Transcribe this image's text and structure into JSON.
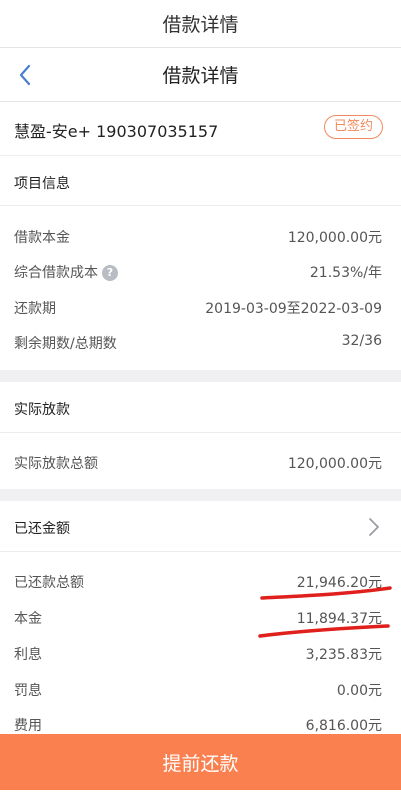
{
  "top_title": "借款详情",
  "nav": {
    "title": "借款详情",
    "back_icon": "chevron-left-icon"
  },
  "loan": {
    "name": "慧盈-安e+ 190307035157",
    "status_badge": "已签约"
  },
  "project_info": {
    "title": "项目信息",
    "rows": [
      {
        "label": "借款本金",
        "value": "120,000.00元"
      },
      {
        "label": "综合借款成本",
        "value": "21.53%/年",
        "has_help": true
      },
      {
        "label": "还款期",
        "value": "2019-03-09至2022-03-09"
      },
      {
        "label": "剩余期数/总期数",
        "value": "32/36"
      }
    ]
  },
  "disbursement": {
    "title": "实际放款",
    "rows": [
      {
        "label": "实际放款总额",
        "value": "120,000.00元"
      }
    ]
  },
  "repaid": {
    "title": "已还金额",
    "rows": [
      {
        "label": "已还款总额",
        "value": "21,946.20元"
      },
      {
        "label": "本金",
        "value": "11,894.37元"
      },
      {
        "label": "利息",
        "value": "3,235.83元"
      },
      {
        "label": "罚息",
        "value": "0.00元"
      },
      {
        "label": "费用",
        "value": "6,816.00元"
      }
    ]
  },
  "bottom_button": "提前还款",
  "colors": {
    "accent": "#fa8050",
    "badge": "#f08a5d",
    "annotation": "#e0201c"
  }
}
